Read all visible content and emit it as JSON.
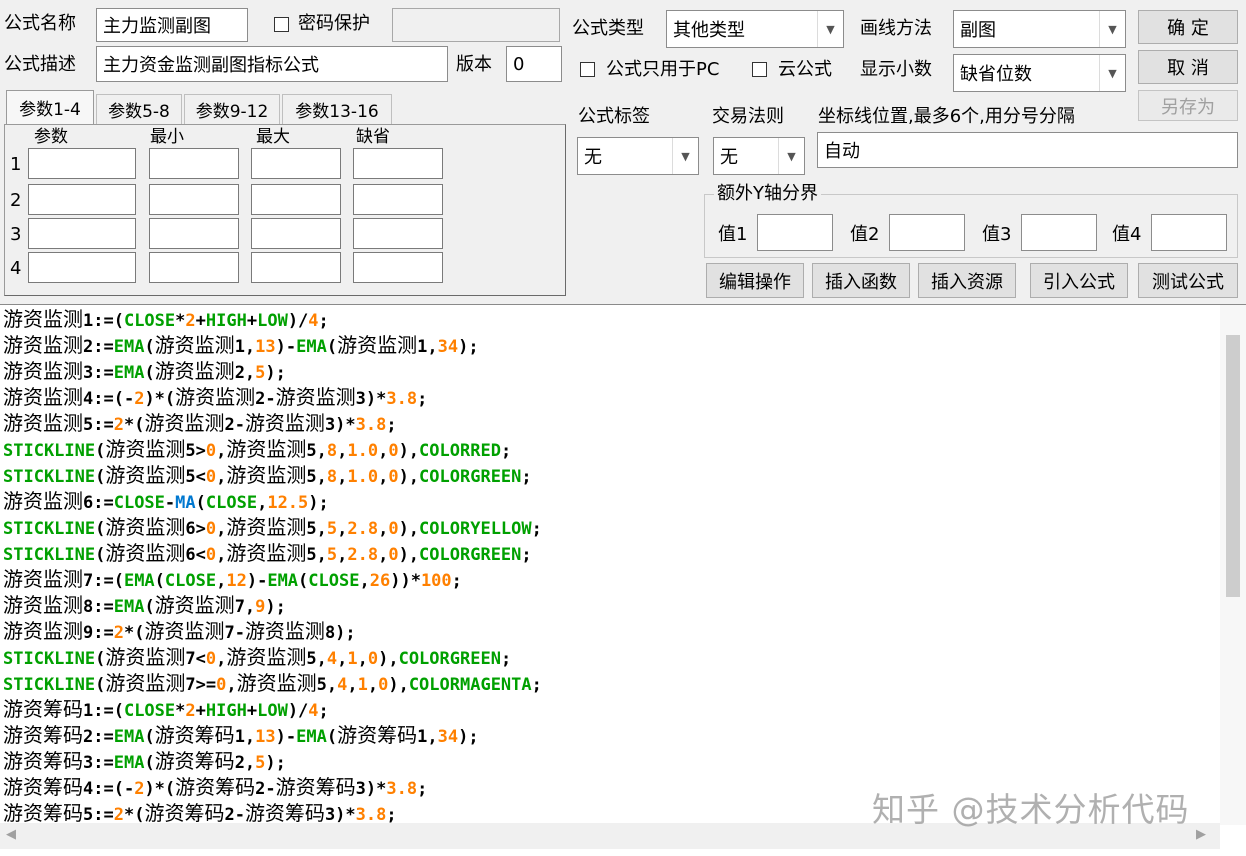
{
  "header": {
    "name_label": "公式名称",
    "name_value": "主力监测副图",
    "password_label": "密码保护",
    "desc_label": "公式描述",
    "desc_value": "主力资金监测副图指标公式",
    "version_label": "版本",
    "version_value": "0",
    "type_label": "公式类型",
    "type_value": "其他类型",
    "draw_label": "画线方法",
    "draw_value": "副图",
    "pc_only_label": "公式只用于PC",
    "cloud_label": "云公式",
    "decimal_label": "显示小数",
    "decimal_value": "缺省位数"
  },
  "buttons": {
    "ok": "确  定",
    "cancel": "取  消",
    "save_as": "另存为",
    "edit_ops": "编辑操作",
    "insert_func": "插入函数",
    "insert_res": "插入资源",
    "import_formula": "引入公式",
    "test_formula": "测试公式"
  },
  "params": {
    "tabs": [
      "参数1-4",
      "参数5-8",
      "参数9-12",
      "参数13-16"
    ],
    "columns": [
      "参数",
      "最小",
      "最大",
      "缺省"
    ],
    "rows": [
      "1",
      "2",
      "3",
      "4"
    ]
  },
  "options": {
    "tag_label": "公式标签",
    "tag_value": "无",
    "rule_label": "交易法则",
    "rule_value": "无",
    "coord_label": "坐标线位置,最多6个,用分号分隔",
    "coord_value": "自动",
    "yaxis_title": "额外Y轴分界",
    "val_labels": [
      "值1",
      "值2",
      "值3",
      "值4"
    ]
  },
  "code_lines": [
    [
      [
        "cn",
        "游资监测"
      ],
      [
        "op",
        "1:=("
      ],
      [
        "fn",
        "CLOSE"
      ],
      [
        "op",
        "*"
      ],
      [
        "num",
        "2"
      ],
      [
        "op",
        "+"
      ],
      [
        "fn",
        "HIGH"
      ],
      [
        "op",
        "+"
      ],
      [
        "fn",
        "LOW"
      ],
      [
        "op",
        ")/"
      ],
      [
        "num",
        "4"
      ],
      [
        "op",
        ";"
      ]
    ],
    [
      [
        "cn",
        "游资监测"
      ],
      [
        "op",
        "2:="
      ],
      [
        "fn",
        "EMA"
      ],
      [
        "op",
        "("
      ],
      [
        "cn",
        "游资监测"
      ],
      [
        "op",
        "1,"
      ],
      [
        "num",
        "13"
      ],
      [
        "op",
        ")-"
      ],
      [
        "fn",
        "EMA"
      ],
      [
        "op",
        "("
      ],
      [
        "cn",
        "游资监测"
      ],
      [
        "op",
        "1,"
      ],
      [
        "num",
        "34"
      ],
      [
        "op",
        ");"
      ]
    ],
    [
      [
        "cn",
        "游资监测"
      ],
      [
        "op",
        "3:="
      ],
      [
        "fn",
        "EMA"
      ],
      [
        "op",
        "("
      ],
      [
        "cn",
        "游资监测"
      ],
      [
        "op",
        "2,"
      ],
      [
        "num",
        "5"
      ],
      [
        "op",
        ");"
      ]
    ],
    [
      [
        "cn",
        "游资监测"
      ],
      [
        "op",
        "4:=(-"
      ],
      [
        "num",
        "2"
      ],
      [
        "op",
        ")*("
      ],
      [
        "cn",
        "游资监测"
      ],
      [
        "op",
        "2-"
      ],
      [
        "cn",
        "游资监测"
      ],
      [
        "op",
        "3)*"
      ],
      [
        "num",
        "3.8"
      ],
      [
        "op",
        ";"
      ]
    ],
    [
      [
        "cn",
        "游资监测"
      ],
      [
        "op",
        "5:="
      ],
      [
        "num",
        "2"
      ],
      [
        "op",
        "*("
      ],
      [
        "cn",
        "游资监测"
      ],
      [
        "op",
        "2-"
      ],
      [
        "cn",
        "游资监测"
      ],
      [
        "op",
        "3)*"
      ],
      [
        "num",
        "3.8"
      ],
      [
        "op",
        ";"
      ]
    ],
    [
      [
        "fn",
        "STICKLINE"
      ],
      [
        "op",
        "("
      ],
      [
        "cn",
        "游资监测"
      ],
      [
        "op",
        "5>"
      ],
      [
        "num",
        "0"
      ],
      [
        "op",
        ","
      ],
      [
        "cn",
        "游资监测"
      ],
      [
        "op",
        "5,"
      ],
      [
        "num",
        "8"
      ],
      [
        "op",
        ","
      ],
      [
        "num",
        "1.0"
      ],
      [
        "op",
        ","
      ],
      [
        "num",
        "0"
      ],
      [
        "op",
        "),"
      ],
      [
        "fn",
        "COLORRED"
      ],
      [
        "op",
        ";"
      ]
    ],
    [
      [
        "fn",
        "STICKLINE"
      ],
      [
        "op",
        "("
      ],
      [
        "cn",
        "游资监测"
      ],
      [
        "op",
        "5<"
      ],
      [
        "num",
        "0"
      ],
      [
        "op",
        ","
      ],
      [
        "cn",
        "游资监测"
      ],
      [
        "op",
        "5,"
      ],
      [
        "num",
        "8"
      ],
      [
        "op",
        ","
      ],
      [
        "num",
        "1.0"
      ],
      [
        "op",
        ","
      ],
      [
        "num",
        "0"
      ],
      [
        "op",
        "),"
      ],
      [
        "fn",
        "COLORGREEN"
      ],
      [
        "op",
        ";"
      ]
    ],
    [
      [
        "cn",
        "游资监测"
      ],
      [
        "op",
        "6:="
      ],
      [
        "fn",
        "CLOSE"
      ],
      [
        "op",
        "-"
      ],
      [
        "ma",
        "MA"
      ],
      [
        "op",
        "("
      ],
      [
        "fn",
        "CLOSE"
      ],
      [
        "op",
        ","
      ],
      [
        "num",
        "12.5"
      ],
      [
        "op",
        ");"
      ]
    ],
    [
      [
        "fn",
        "STICKLINE"
      ],
      [
        "op",
        "("
      ],
      [
        "cn",
        "游资监测"
      ],
      [
        "op",
        "6>"
      ],
      [
        "num",
        "0"
      ],
      [
        "op",
        ","
      ],
      [
        "cn",
        "游资监测"
      ],
      [
        "op",
        "5,"
      ],
      [
        "num",
        "5"
      ],
      [
        "op",
        ","
      ],
      [
        "num",
        "2.8"
      ],
      [
        "op",
        ","
      ],
      [
        "num",
        "0"
      ],
      [
        "op",
        "),"
      ],
      [
        "fn",
        "COLORYELLOW"
      ],
      [
        "op",
        ";"
      ]
    ],
    [
      [
        "fn",
        "STICKLINE"
      ],
      [
        "op",
        "("
      ],
      [
        "cn",
        "游资监测"
      ],
      [
        "op",
        "6<"
      ],
      [
        "num",
        "0"
      ],
      [
        "op",
        ","
      ],
      [
        "cn",
        "游资监测"
      ],
      [
        "op",
        "5,"
      ],
      [
        "num",
        "5"
      ],
      [
        "op",
        ","
      ],
      [
        "num",
        "2.8"
      ],
      [
        "op",
        ","
      ],
      [
        "num",
        "0"
      ],
      [
        "op",
        "),"
      ],
      [
        "fn",
        "COLORGREEN"
      ],
      [
        "op",
        ";"
      ]
    ],
    [
      [
        "cn",
        "游资监测"
      ],
      [
        "op",
        "7:=("
      ],
      [
        "fn",
        "EMA"
      ],
      [
        "op",
        "("
      ],
      [
        "fn",
        "CLOSE"
      ],
      [
        "op",
        ","
      ],
      [
        "num",
        "12"
      ],
      [
        "op",
        ")-"
      ],
      [
        "fn",
        "EMA"
      ],
      [
        "op",
        "("
      ],
      [
        "fn",
        "CLOSE"
      ],
      [
        "op",
        ","
      ],
      [
        "num",
        "26"
      ],
      [
        "op",
        "))*"
      ],
      [
        "num",
        "100"
      ],
      [
        "op",
        ";"
      ]
    ],
    [
      [
        "cn",
        "游资监测"
      ],
      [
        "op",
        "8:="
      ],
      [
        "fn",
        "EMA"
      ],
      [
        "op",
        "("
      ],
      [
        "cn",
        "游资监测"
      ],
      [
        "op",
        "7,"
      ],
      [
        "num",
        "9"
      ],
      [
        "op",
        ");"
      ]
    ],
    [
      [
        "cn",
        "游资监测"
      ],
      [
        "op",
        "9:="
      ],
      [
        "num",
        "2"
      ],
      [
        "op",
        "*("
      ],
      [
        "cn",
        "游资监测"
      ],
      [
        "op",
        "7-"
      ],
      [
        "cn",
        "游资监测"
      ],
      [
        "op",
        "8);"
      ]
    ],
    [
      [
        "fn",
        "STICKLINE"
      ],
      [
        "op",
        "("
      ],
      [
        "cn",
        "游资监测"
      ],
      [
        "op",
        "7<"
      ],
      [
        "num",
        "0"
      ],
      [
        "op",
        ","
      ],
      [
        "cn",
        "游资监测"
      ],
      [
        "op",
        "5,"
      ],
      [
        "num",
        "4"
      ],
      [
        "op",
        ","
      ],
      [
        "num",
        "1"
      ],
      [
        "op",
        ","
      ],
      [
        "num",
        "0"
      ],
      [
        "op",
        "),"
      ],
      [
        "fn",
        "COLORGREEN"
      ],
      [
        "op",
        ";"
      ]
    ],
    [
      [
        "fn",
        "STICKLINE"
      ],
      [
        "op",
        "("
      ],
      [
        "cn",
        "游资监测"
      ],
      [
        "op",
        "7>="
      ],
      [
        "num",
        "0"
      ],
      [
        "op",
        ","
      ],
      [
        "cn",
        "游资监测"
      ],
      [
        "op",
        "5,"
      ],
      [
        "num",
        "4"
      ],
      [
        "op",
        ","
      ],
      [
        "num",
        "1"
      ],
      [
        "op",
        ","
      ],
      [
        "num",
        "0"
      ],
      [
        "op",
        "),"
      ],
      [
        "fn",
        "COLORMAGENTA"
      ],
      [
        "op",
        ";"
      ]
    ],
    [
      [
        "cn",
        "游资筹码"
      ],
      [
        "op",
        "1:=("
      ],
      [
        "fn",
        "CLOSE"
      ],
      [
        "op",
        "*"
      ],
      [
        "num",
        "2"
      ],
      [
        "op",
        "+"
      ],
      [
        "fn",
        "HIGH"
      ],
      [
        "op",
        "+"
      ],
      [
        "fn",
        "LOW"
      ],
      [
        "op",
        ")/"
      ],
      [
        "num",
        "4"
      ],
      [
        "op",
        ";"
      ]
    ],
    [
      [
        "cn",
        "游资筹码"
      ],
      [
        "op",
        "2:="
      ],
      [
        "fn",
        "EMA"
      ],
      [
        "op",
        "("
      ],
      [
        "cn",
        "游资筹码"
      ],
      [
        "op",
        "1,"
      ],
      [
        "num",
        "13"
      ],
      [
        "op",
        ")-"
      ],
      [
        "fn",
        "EMA"
      ],
      [
        "op",
        "("
      ],
      [
        "cn",
        "游资筹码"
      ],
      [
        "op",
        "1,"
      ],
      [
        "num",
        "34"
      ],
      [
        "op",
        ");"
      ]
    ],
    [
      [
        "cn",
        "游资筹码"
      ],
      [
        "op",
        "3:="
      ],
      [
        "fn",
        "EMA"
      ],
      [
        "op",
        "("
      ],
      [
        "cn",
        "游资筹码"
      ],
      [
        "op",
        "2,"
      ],
      [
        "num",
        "5"
      ],
      [
        "op",
        ");"
      ]
    ],
    [
      [
        "cn",
        "游资筹码"
      ],
      [
        "op",
        "4:=(-"
      ],
      [
        "num",
        "2"
      ],
      [
        "op",
        ")*("
      ],
      [
        "cn",
        "游资筹码"
      ],
      [
        "op",
        "2-"
      ],
      [
        "cn",
        "游资筹码"
      ],
      [
        "op",
        "3)*"
      ],
      [
        "num",
        "3.8"
      ],
      [
        "op",
        ";"
      ]
    ],
    [
      [
        "cn",
        "游资筹码"
      ],
      [
        "op",
        "5:="
      ],
      [
        "num",
        "2"
      ],
      [
        "op",
        "*("
      ],
      [
        "cn",
        "游资筹码"
      ],
      [
        "op",
        "2-"
      ],
      [
        "cn",
        "游资筹码"
      ],
      [
        "op",
        "3)*"
      ],
      [
        "num",
        "3.8"
      ],
      [
        "op",
        ";"
      ]
    ]
  ],
  "watermark": "知乎 @技术分析代码",
  "colors": {
    "keyword": "#00a000",
    "number": "#ff8000",
    "ma_function": "#0078d0"
  }
}
